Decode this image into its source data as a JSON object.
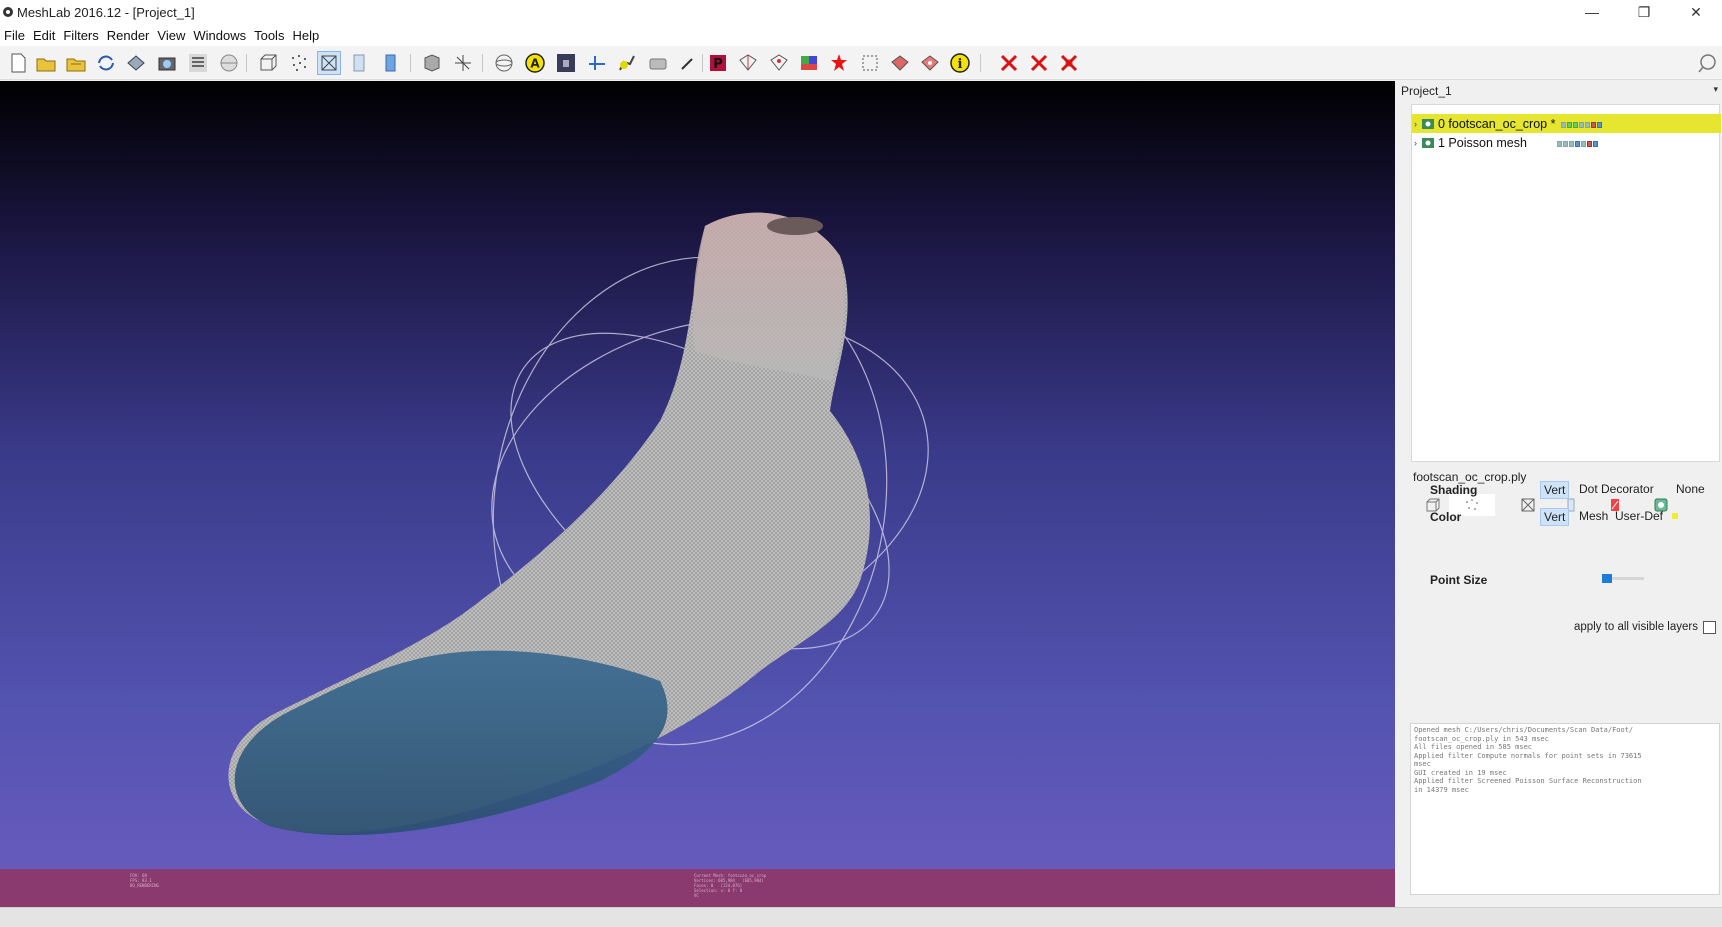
{
  "window": {
    "title": "MeshLab 2016.12 - [Project_1]",
    "minimize": "—",
    "restore": "❐",
    "close": "✕"
  },
  "menu": [
    "File",
    "Edit",
    "Filters",
    "Render",
    "View",
    "Windows",
    "Tools",
    "Help"
  ],
  "toolbar": {
    "icons": [
      "new-project-icon",
      "open-mesh-icon",
      "open-project-icon",
      "reload-icon",
      "save-icon",
      "snapshot-icon",
      "layers-icon",
      "fullscreen-icon",
      "bounding-box-icon",
      "points-icon",
      "wireframe-icon",
      "flat-icon",
      "smooth-icon",
      "light-icon",
      "axes-icon",
      "trackball-icon",
      "annotation-icon",
      "camera-icon",
      "measure-icon",
      "paint-icon",
      "align-icon",
      "pencil-icon",
      "pickpoints-icon",
      "select-faces-icon",
      "select-vertices-icon",
      "color-paint-icon",
      "georef-icon",
      "select-connected-icon",
      "delete-faces-icon",
      "delete-vertices-icon",
      "info-icon",
      "delete-x-icon",
      "delete-x2-icon",
      "delete-x3-icon"
    ],
    "info_glyph": "i",
    "annotation_glyph": "A"
  },
  "project": {
    "header": "Project_1",
    "pin": "▾",
    "layers": [
      {
        "name": "0 footscan_oc_crop *",
        "selected": true
      },
      {
        "name": "1 Poisson mesh",
        "selected": false
      }
    ]
  },
  "render_panel": {
    "file": "footscan_oc_crop.ply",
    "shading_label": "Shading",
    "shading_options": [
      "Vert",
      "Dot Decorator",
      "None"
    ],
    "color_label": "Color",
    "color_options": [
      "Vert",
      "Mesh",
      "User-Def"
    ],
    "point_size_label": "Point Size",
    "apply_label": "apply to all visible layers"
  },
  "log": "Opened mesh C:/Users/chris/Documents/Scan Data/Foot/\nfootscan_oc_crop.ply in 543 msec\nAll files opened in 585 msec\nApplied filter Compute normals for point sets in 73615\nmsec\nGUI created in 19 msec\nApplied filter Screened Poisson Surface Reconstruction\nin 14379 msec",
  "viewport_info": {
    "left": "FOV: 60\nFPS: 83.1\nBO_RENDERING",
    "mid": "Current Mesh: footscan_oc_crop\nVertices: 685,984   (685,984)\nFaces: 0   (124,876)\nSelection: v: 0 f: 0\nVC"
  },
  "colors": {
    "selected_layer": "#e6e631",
    "viewport_top": "#000000",
    "viewport_bottom": "#6a5cc0",
    "info_bar": "#8a3a6e"
  }
}
